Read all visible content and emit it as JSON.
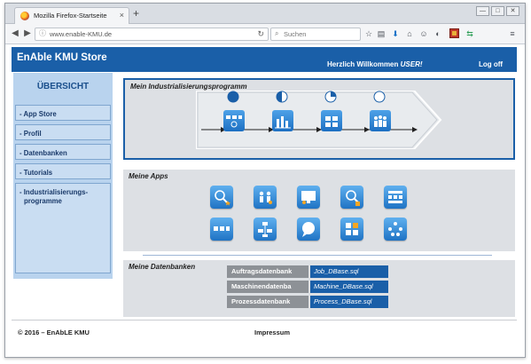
{
  "browser": {
    "tab_title": "Mozilla Firefox-Startseite",
    "tab_close": "×",
    "new_tab": "+",
    "url": "www.enable-KMU.de",
    "search_placeholder": "Suchen",
    "window_buttons": [
      "—",
      "□",
      "✕"
    ],
    "toolbar_icons": [
      "star-icon",
      "reading-list-icon",
      "download-icon",
      "home-icon",
      "chat-icon",
      "pocket-icon",
      "addon-icon",
      "sync-icon",
      "menu-icon"
    ]
  },
  "header": {
    "brand": "EnAble KMU Store",
    "welcome_prefix": "Herzlich Willkommen",
    "welcome_user": "USER!",
    "logoff": "Log off"
  },
  "sidebar": {
    "title": "ÜBERSICHT",
    "items": [
      {
        "label": "- App Store"
      },
      {
        "label": "- Profil"
      },
      {
        "label": "- Datenbanken"
      },
      {
        "label": "- Tutorials"
      },
      {
        "label": "- Industrialisierungs-"
      },
      {
        "label": "programme"
      }
    ]
  },
  "program": {
    "title": "Mein Industrialisierungsprogramm",
    "stages": [
      {
        "progress": 1.0,
        "icon": "process-icon"
      },
      {
        "progress": 0.5,
        "icon": "bar-chart-icon"
      },
      {
        "progress": 0.25,
        "icon": "grid-icon"
      },
      {
        "progress": 0.0,
        "icon": "people-icon"
      }
    ]
  },
  "apps": {
    "title": "Meine Apps",
    "items": [
      {
        "icon": "search-star-icon"
      },
      {
        "icon": "people-settings-icon"
      },
      {
        "icon": "monitor-user-icon"
      },
      {
        "icon": "search-doc-icon"
      },
      {
        "icon": "dashboard-grid-icon"
      },
      {
        "icon": "process-flow-icon"
      },
      {
        "icon": "hierarchy-icon"
      },
      {
        "icon": "chat-bubble-icon"
      },
      {
        "icon": "module-grid-icon"
      },
      {
        "icon": "network-icon"
      }
    ]
  },
  "databases": {
    "title": "Meine Datenbanken",
    "rows": [
      {
        "name": "Auftragsdatenbank",
        "file": "Job_DBase.sql"
      },
      {
        "name": "Maschinendatenba",
        "file": "Machine_DBase.sql"
      },
      {
        "name": "Prozessdatenbank",
        "file": "Process_DBase.sql"
      }
    ]
  },
  "footer": {
    "copyright": "© 2016 – EnAbLE KMU",
    "impressum": "Impressum"
  }
}
